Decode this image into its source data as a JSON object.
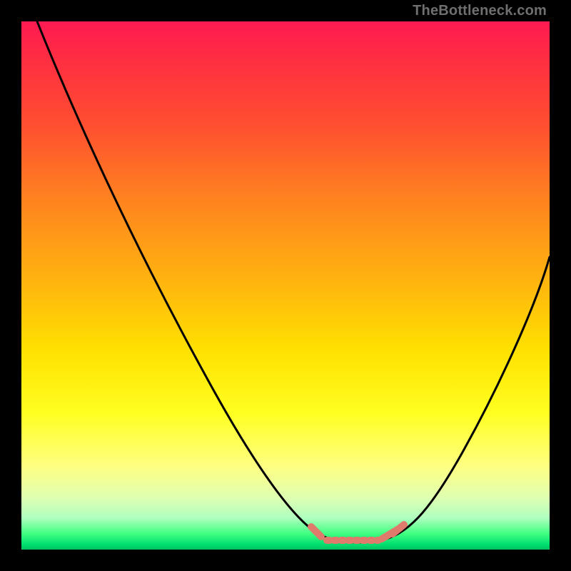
{
  "watermark": "TheBottleneck.com",
  "chart_data": {
    "type": "line",
    "title": "",
    "xlabel": "",
    "ylabel": "",
    "xlim": [
      0,
      100
    ],
    "ylim": [
      0,
      100
    ],
    "grid": false,
    "series": [
      {
        "name": "bottleneck-curve",
        "x": [
          3,
          10,
          20,
          30,
          40,
          50,
          55,
          58,
          60,
          63,
          66,
          70,
          72,
          75,
          80,
          85,
          90,
          95,
          100
        ],
        "y": [
          100,
          88,
          72,
          55,
          38,
          20,
          10,
          5,
          3,
          2,
          2,
          3,
          5,
          9,
          17,
          26,
          36,
          46,
          56
        ],
        "color": "#000000"
      }
    ],
    "tick_segments": {
      "left": {
        "x_range": [
          55,
          58
        ],
        "y": 4,
        "color": "#e07a6a"
      },
      "right": {
        "x_range": [
          68,
          72
        ],
        "y": 5,
        "color": "#e07a6a"
      },
      "bottom": {
        "x_range": [
          58,
          70
        ],
        "y": 2,
        "color": "#e07a6a"
      }
    },
    "background_gradient": {
      "type": "vertical",
      "stops": [
        {
          "pos": 0,
          "color": "#ff1a52"
        },
        {
          "pos": 50,
          "color": "#ffd000"
        },
        {
          "pos": 80,
          "color": "#ffff60"
        },
        {
          "pos": 100,
          "color": "#00d070"
        }
      ]
    }
  }
}
